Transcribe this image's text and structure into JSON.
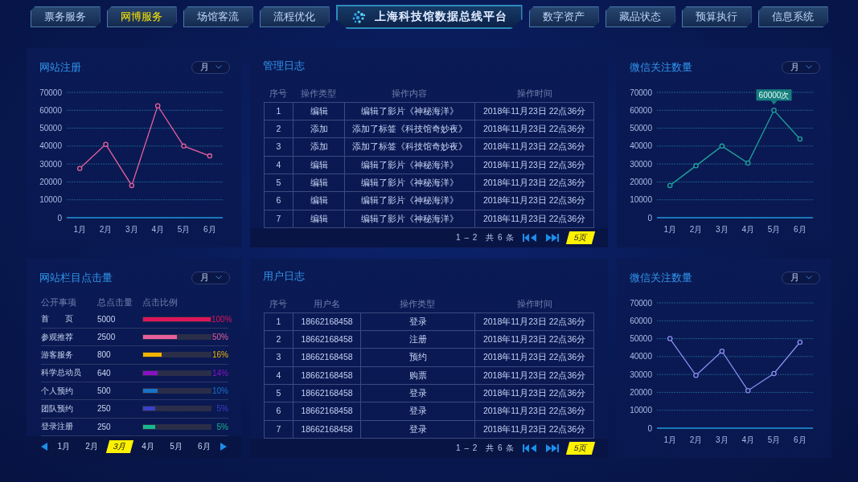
{
  "nav_left": [
    {
      "label": "票务服务",
      "selected": false
    },
    {
      "label": "网博服务",
      "selected": true
    },
    {
      "label": "场馆客流",
      "selected": false
    },
    {
      "label": "流程优化",
      "selected": false
    }
  ],
  "title": "上海科技馆数据总线平台",
  "nav_right": [
    {
      "label": "数字资产",
      "selected": false
    },
    {
      "label": "藏品状态",
      "selected": false
    },
    {
      "label": "预算执行",
      "selected": false
    },
    {
      "label": "信息系统",
      "selected": false
    }
  ],
  "registration_panel": {
    "title": "网站注册",
    "period": "月",
    "chart_data": {
      "type": "line",
      "categories": [
        "1月",
        "2月",
        "3月",
        "4月",
        "5月",
        "6月"
      ],
      "ylim": [
        0,
        70000
      ],
      "yticks": [
        0,
        10000,
        20000,
        30000,
        40000,
        50000,
        60000,
        70000
      ],
      "grid": true,
      "series": [
        {
          "color": "#e2609e",
          "marker": true,
          "values": [
            27500,
            41000,
            18000,
            62500,
            40000,
            34500
          ]
        }
      ]
    }
  },
  "admin_log": {
    "title": "管理日志",
    "columns": [
      "序号",
      "操作类型",
      "操作内容",
      "操作时间"
    ],
    "rows": [
      [
        "1",
        "编辑",
        "编辑了影片《神秘海洋》",
        "2018年11月23日 22点36分"
      ],
      [
        "2",
        "添加",
        "添加了标签《科技馆奇妙夜》",
        "2018年11月23日 22点36分"
      ],
      [
        "3",
        "添加",
        "添加了标签《科技馆奇妙夜》",
        "2018年11月23日 22点36分"
      ],
      [
        "4",
        "编辑",
        "编辑了影片《神秘海洋》",
        "2018年11月23日 22点36分"
      ],
      [
        "5",
        "编辑",
        "编辑了影片《神秘海洋》",
        "2018年11月23日 22点36分"
      ],
      [
        "6",
        "编辑",
        "编辑了影片《神秘海洋》",
        "2018年11月23日 22点36分"
      ],
      [
        "7",
        "编辑",
        "编辑了影片《神秘海洋》",
        "2018年11月23日 22点36分"
      ]
    ],
    "pagination": {
      "range": "1 – 2",
      "total": "共 6 条",
      "page": "5页"
    }
  },
  "wechat_panel": {
    "title": "微信关注数量",
    "period": "月",
    "chart_data": {
      "type": "line",
      "categories": [
        "1月",
        "2月",
        "3月",
        "4月",
        "5月",
        "6月"
      ],
      "ylim": [
        0,
        70000
      ],
      "yticks": [
        0,
        10000,
        20000,
        30000,
        40000,
        50000,
        60000,
        70000
      ],
      "grid": true,
      "series": [
        {
          "color": "#1fa3a0",
          "marker": true,
          "values": [
            18000,
            29000,
            40000,
            30500,
            60000,
            44000
          ]
        }
      ],
      "annotations": [
        {
          "x": "5月",
          "y": 60000,
          "text": "60000次"
        }
      ]
    }
  },
  "clicks_panel": {
    "title": "网站栏目点击量",
    "period": "月",
    "columns": [
      "公开事项",
      "总点击量",
      "点击比例"
    ],
    "rows": [
      {
        "name": "首　　页",
        "count": "5000",
        "level": 1.0,
        "percent": "100%",
        "color": "#e0145a"
      },
      {
        "name": "参观推荐",
        "count": "2500",
        "level": 0.5,
        "percent": "50%",
        "color": "#e9609e"
      },
      {
        "name": "游客服务",
        "count": "800",
        "level": 0.27,
        "percent": "16%",
        "color": "#f5b400"
      },
      {
        "name": "科学总动员",
        "count": "640",
        "level": 0.22,
        "percent": "14%",
        "color": "#8a10c8"
      },
      {
        "name": "个人预约",
        "count": "500",
        "level": 0.21,
        "percent": "10%",
        "color": "#1a72c8"
      },
      {
        "name": "团队预约",
        "count": "250",
        "level": 0.18,
        "percent": "5%",
        "color": "#3a40c8"
      },
      {
        "name": "登录注册",
        "count": "250",
        "level": 0.18,
        "percent": "5%",
        "color": "#16b890"
      }
    ],
    "months": [
      {
        "label": "1月",
        "selected": false
      },
      {
        "label": "2月",
        "selected": false
      },
      {
        "label": "3月",
        "selected": true
      },
      {
        "label": "4月",
        "selected": false
      },
      {
        "label": "5月",
        "selected": false
      },
      {
        "label": "6月",
        "selected": false
      }
    ]
  },
  "user_log": {
    "title": "用户日志",
    "columns": [
      "序号",
      "用户名",
      "操作类型",
      "操作时间"
    ],
    "rows": [
      [
        "1",
        "18662168458",
        "登录",
        "2018年11月23日 22点36分"
      ],
      [
        "2",
        "18662168458",
        "注册",
        "2018年11月23日 22点36分"
      ],
      [
        "3",
        "18662168458",
        "预约",
        "2018年11月23日 22点36分"
      ],
      [
        "4",
        "18662168458",
        "购票",
        "2018年11月23日 22点36分"
      ],
      [
        "5",
        "18662168458",
        "登录",
        "2018年11月23日 22点36分"
      ],
      [
        "6",
        "18662168458",
        "登录",
        "2018年11月23日 22点36分"
      ],
      [
        "7",
        "18662168458",
        "登录",
        "2018年11月23日 22点36分"
      ]
    ],
    "pagination": {
      "range": "1 – 2",
      "total": "共 6 条",
      "page": "5页"
    }
  },
  "wechat_panel_2": {
    "title": "微信关注数量",
    "period": "月",
    "chart_data": {
      "type": "line",
      "categories": [
        "1月",
        "2月",
        "3月",
        "4月",
        "5月",
        "6月"
      ],
      "ylim": [
        0,
        70000
      ],
      "yticks": [
        0,
        10000,
        20000,
        30000,
        40000,
        50000,
        60000,
        70000
      ],
      "grid": true,
      "series": [
        {
          "color": "#8a8ff0",
          "marker": true,
          "values": [
            50000,
            29500,
            43000,
            21000,
            30500,
            48000
          ]
        }
      ]
    }
  }
}
